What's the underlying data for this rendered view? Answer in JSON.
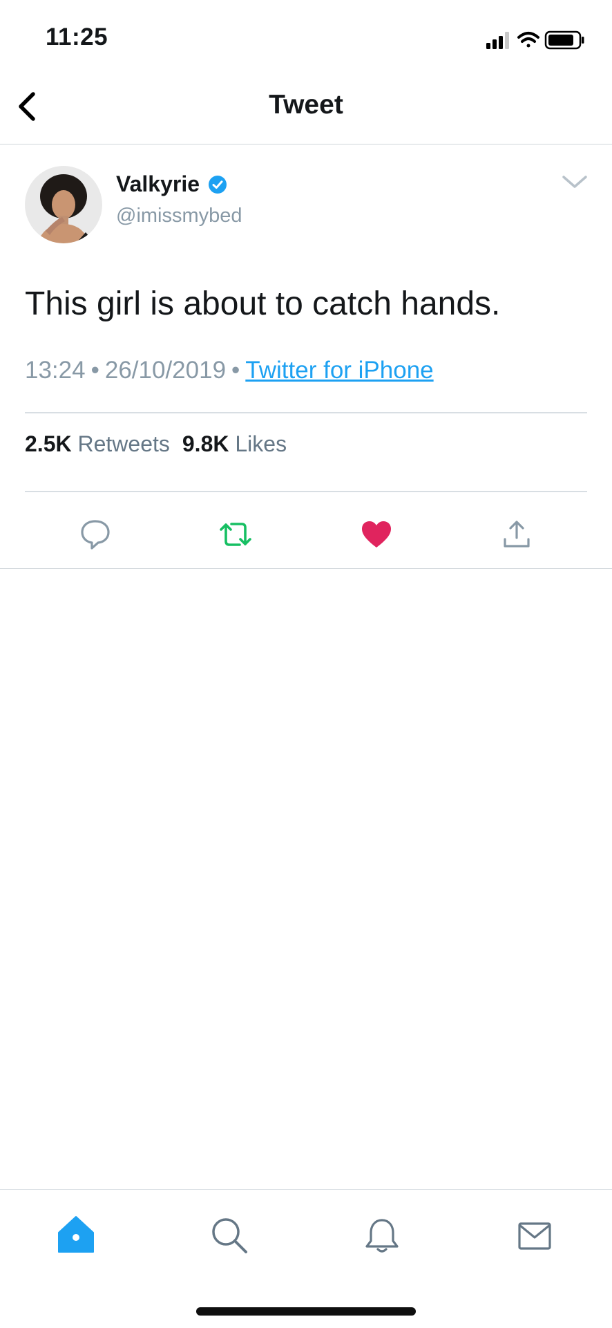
{
  "status_bar": {
    "time": "11:25"
  },
  "nav": {
    "title": "Tweet",
    "back_icon": "chevron-left-icon"
  },
  "tweet": {
    "display_name": "Valkyrie",
    "handle": "@imissmybed",
    "text": "This girl is about to catch hands.",
    "time": "13:24",
    "date": "26/10/2019",
    "separator": "•",
    "source": "Twitter for iPhone",
    "stats": {
      "retweets_count": "2.5K",
      "retweets_label": "Retweets",
      "likes_count": "9.8K",
      "likes_label": "Likes"
    },
    "actions": {
      "reply_icon": "reply-icon",
      "retweet_icon": "retweet-icon",
      "like_icon": "heart-icon",
      "share_icon": "share-icon"
    }
  },
  "tab_bar": {
    "tabs": [
      "home-icon",
      "search-icon",
      "bell-icon",
      "mail-icon"
    ],
    "active": "home-icon"
  },
  "colors": {
    "accent": "#1da1f2",
    "retweet": "#17bf63",
    "like": "#e0245e",
    "secondary_text": "#8899a6"
  }
}
